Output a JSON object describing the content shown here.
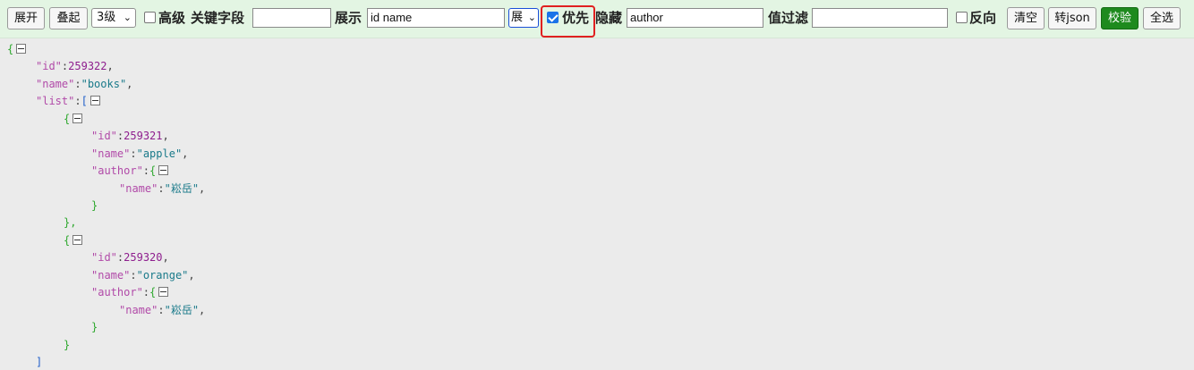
{
  "toolbar": {
    "expand_label": "展开",
    "collapse_label": "叠起",
    "level_value": "3级",
    "advanced_label": "高级",
    "keyword_label": "关键字段",
    "keyword_value": "",
    "show_label": "展示",
    "show_value": "id name",
    "show_mode_value": "展",
    "priority_label": "优先",
    "priority_checked": true,
    "hide_label": "隐藏",
    "hide_value": "author",
    "filter_label": "值过滤",
    "filter_value": "",
    "reverse_label": "反向",
    "clear_label": "清空",
    "to_json_label": "转json",
    "validate_label": "校验",
    "select_all_label": "全选",
    "validate_color": "#1e8a1e",
    "highlight_color": "#e02020"
  },
  "json_view": {
    "root_open": "{",
    "id_key": "\"id\"",
    "id_value": "259322",
    "name_key": "\"name\"",
    "name_value": "\"books\"",
    "list_key": "\"list\"",
    "list_open": "[",
    "items": [
      {
        "open": "{",
        "id_key": "\"id\"",
        "id_value": "259321",
        "name_key": "\"name\"",
        "name_value": "\"apple\"",
        "author_key": "\"author\"",
        "author_open": "{",
        "author_name_key": "\"name\"",
        "author_name_value": "\"崧岳\"",
        "author_close": "}",
        "close": "},"
      },
      {
        "open": "{",
        "id_key": "\"id\"",
        "id_value": "259320",
        "name_key": "\"name\"",
        "name_value": "\"orange\"",
        "author_key": "\"author\"",
        "author_open": "{",
        "author_name_key": "\"name\"",
        "author_name_value": "\"崧岳\"",
        "author_close": "}",
        "close": "}"
      }
    ],
    "list_close": "]"
  }
}
